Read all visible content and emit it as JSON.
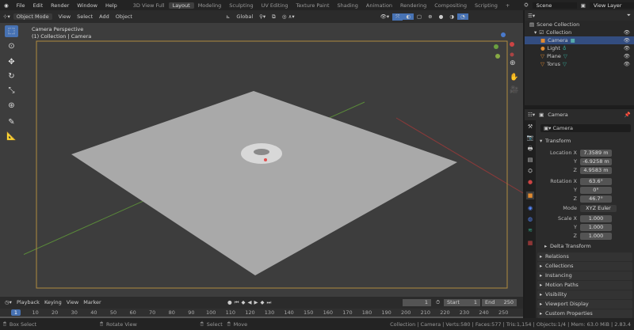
{
  "menu": [
    "File",
    "Edit",
    "Render",
    "Window",
    "Help"
  ],
  "workspaces": [
    "3D View Full",
    "Layout",
    "Modeling",
    "Sculpting",
    "UV Editing",
    "Texture Paint",
    "Shading",
    "Animation",
    "Rendering",
    "Compositing",
    "Scripting"
  ],
  "active_workspace": "Layout",
  "scene": "Scene",
  "view_layer": "View Layer",
  "viewport_header": {
    "mode": "Object Mode",
    "menus": [
      "View",
      "Select",
      "Add",
      "Object"
    ],
    "orientation": "Global"
  },
  "viewport": {
    "title": "Camera Perspective",
    "subtitle": "(1) Collection | Camera"
  },
  "outliner": {
    "root": "Scene Collection",
    "collection": "Collection",
    "items": [
      "Camera",
      "Light",
      "Plane",
      "Torus"
    ],
    "selected": "Camera"
  },
  "properties": {
    "object": "Camera",
    "data_name": "Camera",
    "transform": "Transform",
    "location_label": "Location X",
    "location": [
      "7.3589 m",
      "-6.9258 m",
      "4.9583 m"
    ],
    "rotation_label": "Rotation X",
    "rotation": [
      "63.6°",
      "0°",
      "46.7°"
    ],
    "mode_label": "Mode",
    "mode": "XYZ Euler",
    "scale_label": "Scale X",
    "scale": [
      "1.000",
      "1.000",
      "1.000"
    ],
    "axis_y": "Y",
    "axis_z": "Z",
    "panels": [
      "Delta Transform",
      "Relations",
      "Collections",
      "Instancing",
      "Motion Paths",
      "Visibility",
      "Viewport Display",
      "Custom Properties"
    ]
  },
  "timeline": {
    "menus": [
      "Playback",
      "Keying",
      "View",
      "Marker"
    ],
    "current_frame": "1",
    "start_label": "Start",
    "start": "1",
    "end_label": "End",
    "end": "250",
    "ticks": [
      "1",
      "10",
      "20",
      "30",
      "40",
      "50",
      "60",
      "70",
      "80",
      "90",
      "100",
      "110",
      "120",
      "130",
      "140",
      "150",
      "160",
      "170",
      "180",
      "190",
      "200",
      "210",
      "220",
      "230",
      "240",
      "250"
    ]
  },
  "status": {
    "left": "Box Select",
    "middle": "Rotate View",
    "select": "Select",
    "move": "Move",
    "stats": "Collection | Camera | Verts:580 | Faces:577 | Tris:1,154 | Objects:1/4 | Mem: 63.0 MiB | 2.83.4"
  },
  "colors": {
    "accent": "#4772b3",
    "selection": "#334d80",
    "camera_frame": "#c8a040"
  }
}
